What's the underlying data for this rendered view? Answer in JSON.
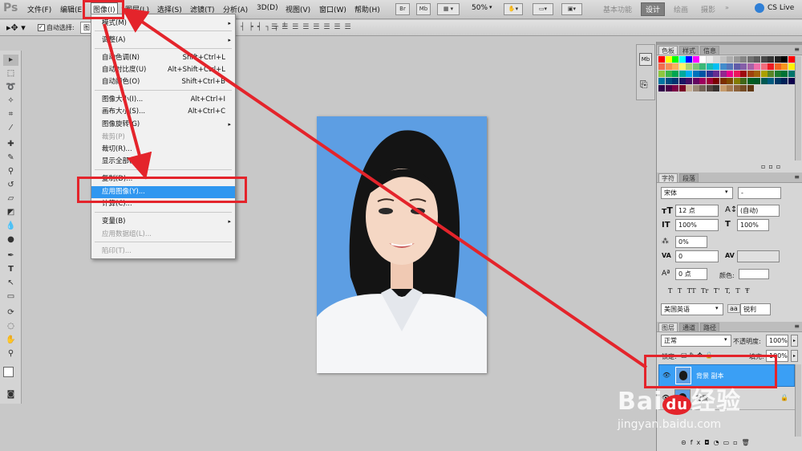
{
  "app": {
    "logo": "Ps"
  },
  "menubar": {
    "items": [
      "文件(F)",
      "编辑(E)",
      "图像(I)",
      "图层(L)",
      "选择(S)",
      "滤镜(T)",
      "分析(A)",
      "3D(D)",
      "视图(V)",
      "窗口(W)",
      "帮助(H)"
    ],
    "zoom": "50%",
    "workspaces": [
      "基本功能",
      "设计",
      "绘画",
      "摄影"
    ],
    "cslive": "CS Live"
  },
  "options": {
    "auto_select_label": "自动选择:",
    "auto_select_value": "图"
  },
  "image_menu": {
    "items": [
      {
        "label": "模式(M)",
        "shortcut": "",
        "sub": true
      },
      {
        "label": "调整(A)",
        "shortcut": "",
        "sub": true
      },
      {
        "label": "自动色调(N)",
        "shortcut": "Shift+Ctrl+L"
      },
      {
        "label": "自动对比度(U)",
        "shortcut": "Alt+Shift+Ctrl+L"
      },
      {
        "label": "自动颜色(O)",
        "shortcut": "Shift+Ctrl+B"
      },
      {
        "label": "图像大小(I)...",
        "shortcut": "Alt+Ctrl+I"
      },
      {
        "label": "画布大小(S)...",
        "shortcut": "Alt+Ctrl+C"
      },
      {
        "label": "图像旋转(G)",
        "shortcut": "",
        "sub": true
      },
      {
        "label": "裁剪(P)",
        "shortcut": "",
        "disabled": true
      },
      {
        "label": "裁切(R)...",
        "shortcut": ""
      },
      {
        "label": "显示全部(V)",
        "shortcut": ""
      },
      {
        "label": "复制(D)...",
        "shortcut": ""
      },
      {
        "label": "应用图像(Y)...",
        "shortcut": "",
        "highlighted": true
      },
      {
        "label": "计算(C)...",
        "shortcut": ""
      },
      {
        "label": "变量(B)",
        "shortcut": "",
        "sub": true
      },
      {
        "label": "应用数据组(L)...",
        "shortcut": "",
        "disabled": true
      },
      {
        "label": "陷印(T)...",
        "shortcut": "",
        "disabled": true
      }
    ]
  },
  "swatches_panel": {
    "tabs": [
      "色板",
      "样式",
      "信息"
    ]
  },
  "char_panel": {
    "tabs": [
      "字符",
      "段落"
    ],
    "font_family": "宋体",
    "font_style": "-",
    "font_size": "12 点",
    "leading": "(自动)",
    "vscale": "100%",
    "hscale": "100%",
    "tracking_pct": "0%",
    "kerning": "0",
    "baseline": "0 点",
    "color_label": "颜色:",
    "type_styles": [
      "T",
      "T",
      "TT",
      "Tr",
      "T'",
      "T,",
      "T",
      "Ŧ"
    ],
    "language": "美国英语",
    "aa_icon": "aa",
    "antialias": "锐利"
  },
  "layers_panel": {
    "tabs": [
      "图层",
      "通道",
      "路径"
    ],
    "blend_mode": "正常",
    "opacity_label": "不透明度:",
    "opacity": "100%",
    "lock_label": "锁定:",
    "fill_label": "填充:",
    "fill": "100%",
    "layers": [
      {
        "name": "背景 副本",
        "selected": true
      },
      {
        "name": "背景",
        "selected": false
      }
    ]
  },
  "watermark": {
    "brand": "Bai",
    "paw": "du",
    "tail": "经验",
    "url": "jingyan.baidu.com"
  },
  "colors": {
    "highlight": "#2f97f0",
    "annotation": "#e4242b",
    "canvas_bg": "#5d9ee3",
    "layer_selected": "#3a9ff5"
  }
}
